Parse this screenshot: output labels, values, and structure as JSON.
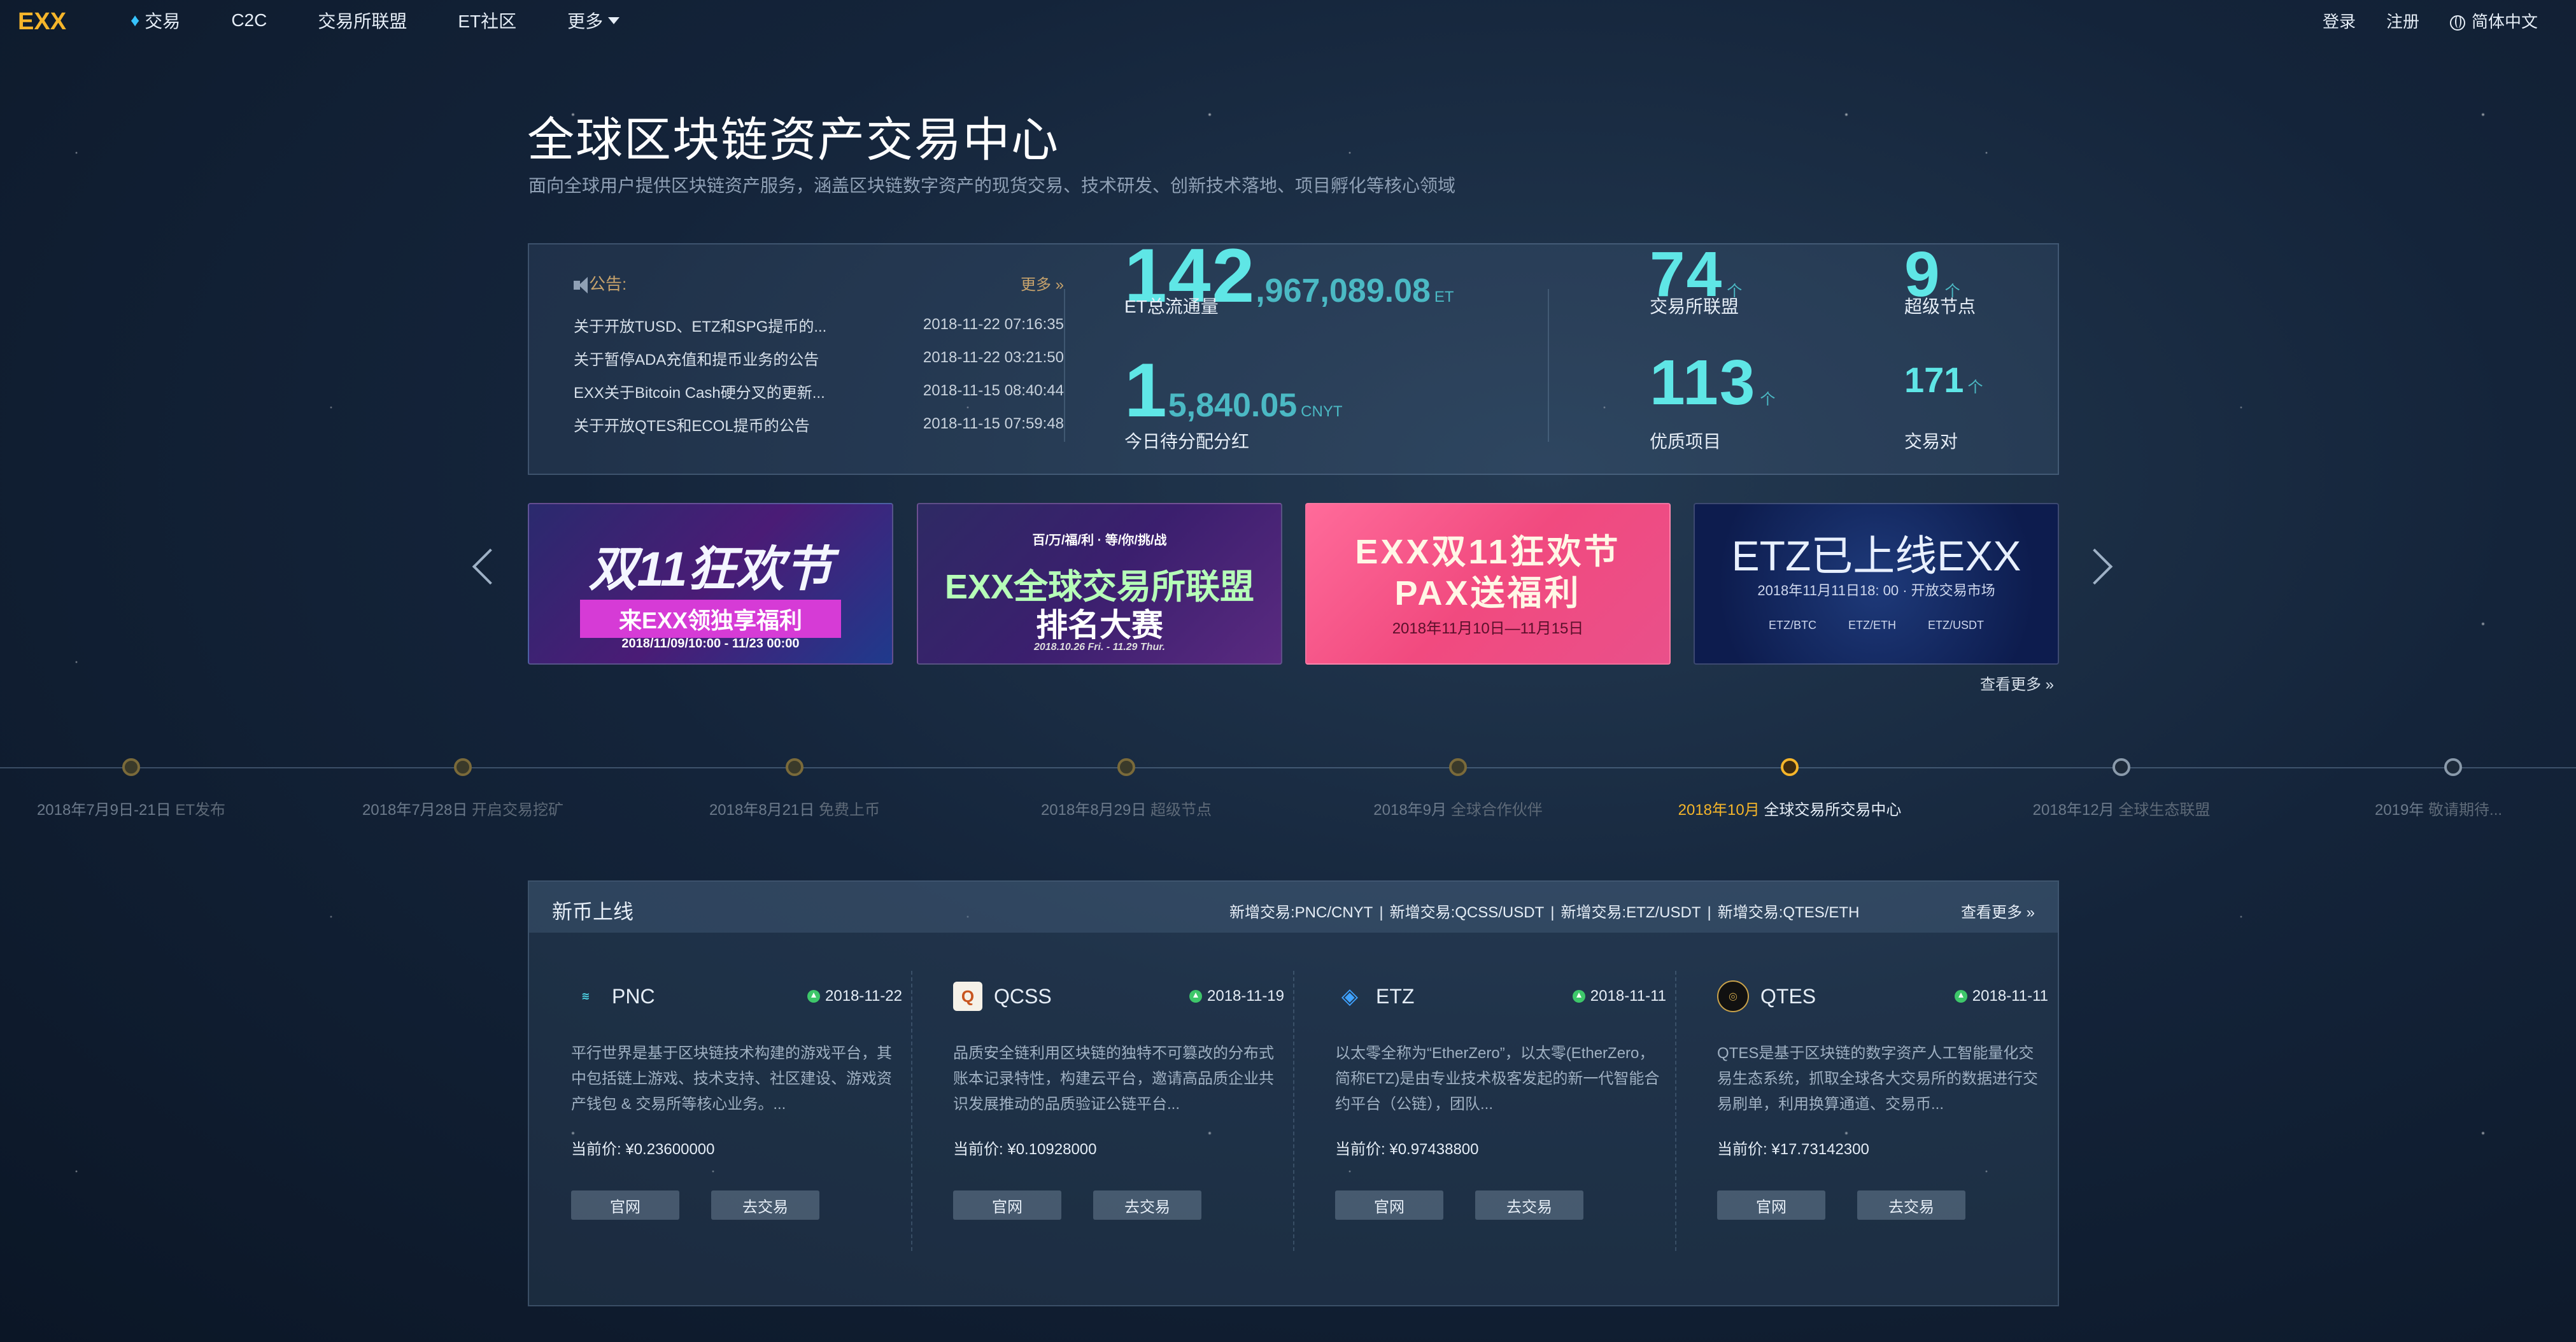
{
  "nav": {
    "logo": "EXX",
    "items": [
      "交易",
      "C2C",
      "交易所联盟",
      "ET社区",
      "更多"
    ],
    "right": {
      "login": "登录",
      "register": "注册",
      "language": "简体中文"
    }
  },
  "hero": {
    "title": "全球区块链资产交易中心",
    "subtitle": "面向全球用户提供区块链资产服务，涵盖区块链数字资产的现货交易、技术研发、创新技术落地、项目孵化等核心领域"
  },
  "notice": {
    "title": "公告:",
    "more": "更多 »",
    "items": [
      {
        "title": "关于开放TUSD、ETZ和SPG提币的...",
        "date": "2018-11-22 07:16:35"
      },
      {
        "title": "关于暂停ADA充值和提币业务的公告",
        "date": "2018-11-22 03:21:50"
      },
      {
        "title": "EXX关于Bitcoin Cash硬分叉的更新...",
        "date": "2018-11-15 08:40:44"
      },
      {
        "title": "关于开放QTES和ECOL提币的公告",
        "date": "2018-11-15 07:59:48"
      }
    ]
  },
  "stats": {
    "circulation": {
      "big": "142",
      "rest": ",967,089.08",
      "unit": "ET",
      "label": "ET总流通量"
    },
    "dividend": {
      "big": "1",
      "rest": "5,840.05",
      "unit": "CNYT",
      "label": "今日待分配分红"
    },
    "alliance": {
      "value": "74",
      "unit": "个",
      "label": "交易所联盟"
    },
    "nodes": {
      "value": "9",
      "unit": "个",
      "label": "超级节点"
    },
    "projects": {
      "value": "113",
      "unit": "个",
      "label": "优质项目"
    },
    "pairs": {
      "value": "171",
      "unit": "个",
      "label": "交易对"
    }
  },
  "banners": [
    {
      "line1": "双11狂欢节",
      "line2": "来EXX领独享福利",
      "line3": "2018/11/09/10:00 - 11/23 00:00"
    },
    {
      "line1": "百/万/福/利 · 等/你/挑/战",
      "line2": "EXX全球交易所联盟",
      "line3": "排名大赛",
      "line4": "2018.10.26 Fri. - 11.29 Thur."
    },
    {
      "line1": "EXX双11狂欢节",
      "line2": "PAX送福利",
      "line3": "2018年11月10日—11月15日"
    },
    {
      "line1": "ETZ已上线EXX",
      "line2": "2018年11月11日18: 00 · 开放交易市场",
      "pairs": [
        "ETZ/BTC",
        "ETZ/ETH",
        "ETZ/USDT"
      ]
    }
  ],
  "banners_more": "查看更多 »",
  "timeline": [
    {
      "date": "2018年7月9日-21日",
      "event": "ET发布"
    },
    {
      "date": "2018年7月28日",
      "event": "开启交易挖矿"
    },
    {
      "date": "2018年8月21日",
      "event": "免费上币"
    },
    {
      "date": "2018年8月29日",
      "event": "超级节点"
    },
    {
      "date": "2018年9月",
      "event": "全球合作伙伴"
    },
    {
      "date": "2018年10月",
      "event": "全球交易所交易中心"
    },
    {
      "date": "2018年12月",
      "event": "全球生态联盟"
    },
    {
      "date": "2019年",
      "event": "敬请期待..."
    }
  ],
  "new_coins": {
    "title": "新币上线",
    "news": [
      "新增交易:PNC/CNYT",
      "新增交易:QCSS/USDT",
      "新增交易:ETZ/USDT",
      "新增交易:QTES/ETH"
    ],
    "more": "查看更多 »",
    "coins": [
      {
        "name": "PNC",
        "date": "2018-11-22",
        "desc": "平行世界是基于区块链技术构建的游戏平台，其中包括链上游戏、技术支持、社区建设、游戏资产钱包 & 交易所等核心业务。...",
        "price_label": "当前价:",
        "price": "¥0.23600000",
        "btn_site": "官网",
        "btn_trade": "去交易"
      },
      {
        "name": "QCSS",
        "date": "2018-11-19",
        "desc": "品质安全链利用区块链的独特不可篡改的分布式账本记录特性，构建云平台，邀请高品质企业共识发展推动的品质验证公链平台...",
        "price_label": "当前价:",
        "price": "¥0.10928000",
        "btn_site": "官网",
        "btn_trade": "去交易"
      },
      {
        "name": "ETZ",
        "date": "2018-11-11",
        "desc": "以太零全称为“EtherZero”，以太零(EtherZero，简称ETZ)是由专业技术极客发起的新一代智能合约平台（公链），团队...",
        "price_label": "当前价:",
        "price": "¥0.97438800",
        "btn_site": "官网",
        "btn_trade": "去交易"
      },
      {
        "name": "QTES",
        "date": "2018-11-11",
        "desc": "QTES是基于区块链的数字资产人工智能量化交易生态系统，抓取全球各大交易所的数据进行交易刷单，利用换算通道、交易币...",
        "price_label": "当前价:",
        "price": "¥17.73142300",
        "btn_site": "官网",
        "btn_trade": "去交易"
      }
    ]
  },
  "colors": {
    "accent": "#5fe6e6",
    "gold": "#f5b52a",
    "notice": "#c7a36c"
  }
}
